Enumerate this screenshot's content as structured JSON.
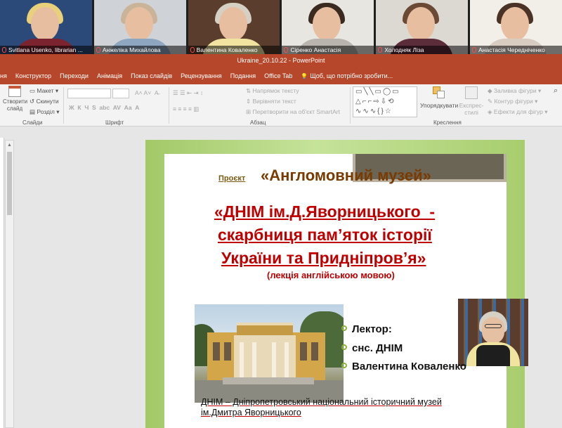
{
  "participants": [
    {
      "name": "Svitlana Usenko, librarian ...",
      "bg": "#2b4a7a",
      "hair": "#e9d07a",
      "shirt": "#7b2430"
    },
    {
      "name": "Анжеліка Михайлова",
      "bg": "#cfd3d8",
      "hair": "#c9b49a",
      "shirt": "#8fa6c0"
    },
    {
      "name": "Валентина Коваленко",
      "bg": "#5a3d2c",
      "hair": "#d6d0c4",
      "shirt": "#f0e4a0"
    },
    {
      "name": "Сіренко Анастасія",
      "bg": "#e8e6e0",
      "hair": "#3a2a20",
      "shirt": "#b9b4ae"
    },
    {
      "name": "Холодняк Ліза",
      "bg": "#dcd8d2",
      "hair": "#6a4a35",
      "shirt": "#5b2c3a"
    },
    {
      "name": "Анастасія Чередніченко",
      "bg": "#f2efe9",
      "hair": "#4a3326",
      "shirt": "#d8ccc0"
    }
  ],
  "title_bar": "Ukraine_20.10.22 - PowerPoint",
  "tabs": [
    "ня",
    "Конструктор",
    "Переходи",
    "Анімація",
    "Показ слайдів",
    "Рецензування",
    "Подання",
    "Office Tab",
    "Щоб, що потрібно зробити..."
  ],
  "ribbon": {
    "create_slide": "Створити слайд",
    "layout": "Макет",
    "reset": "Скинути",
    "section": "Розділ",
    "group_slides": "Слайди",
    "group_font": "Шрифт",
    "group_paragraph": "Абзац",
    "text_direction": "Напрямок тексту",
    "align_text": "Вирівняти текст",
    "smartart": "Перетворити на об'єкт SmartArt",
    "arrange": "Упорядкувати",
    "quick_styles": "Експрес-стилі",
    "shape_fill": "Заливка фігури",
    "shape_outline": "Контур фігури",
    "shape_effects": "Ефекти для фігур",
    "group_drawing": "Креслення"
  },
  "slide": {
    "project_label": "Проєкт",
    "project_title": "«Англомовний музей»",
    "line1": "«ДНІМ ім.Д.Яворницького  -",
    "line2": "скарбниця пам’яток історії",
    "line3": "України та Придніпров’я»",
    "subtitle": "(лекція англійською мовою)",
    "bullets": [
      "Лектор:",
      "снс. ДНІМ",
      "Валентина Коваленко"
    ],
    "footer1": "ДНІМ – Дніпропетровський національний історичний музей",
    "footer2": "ім.Дмитра Яворницького"
  }
}
